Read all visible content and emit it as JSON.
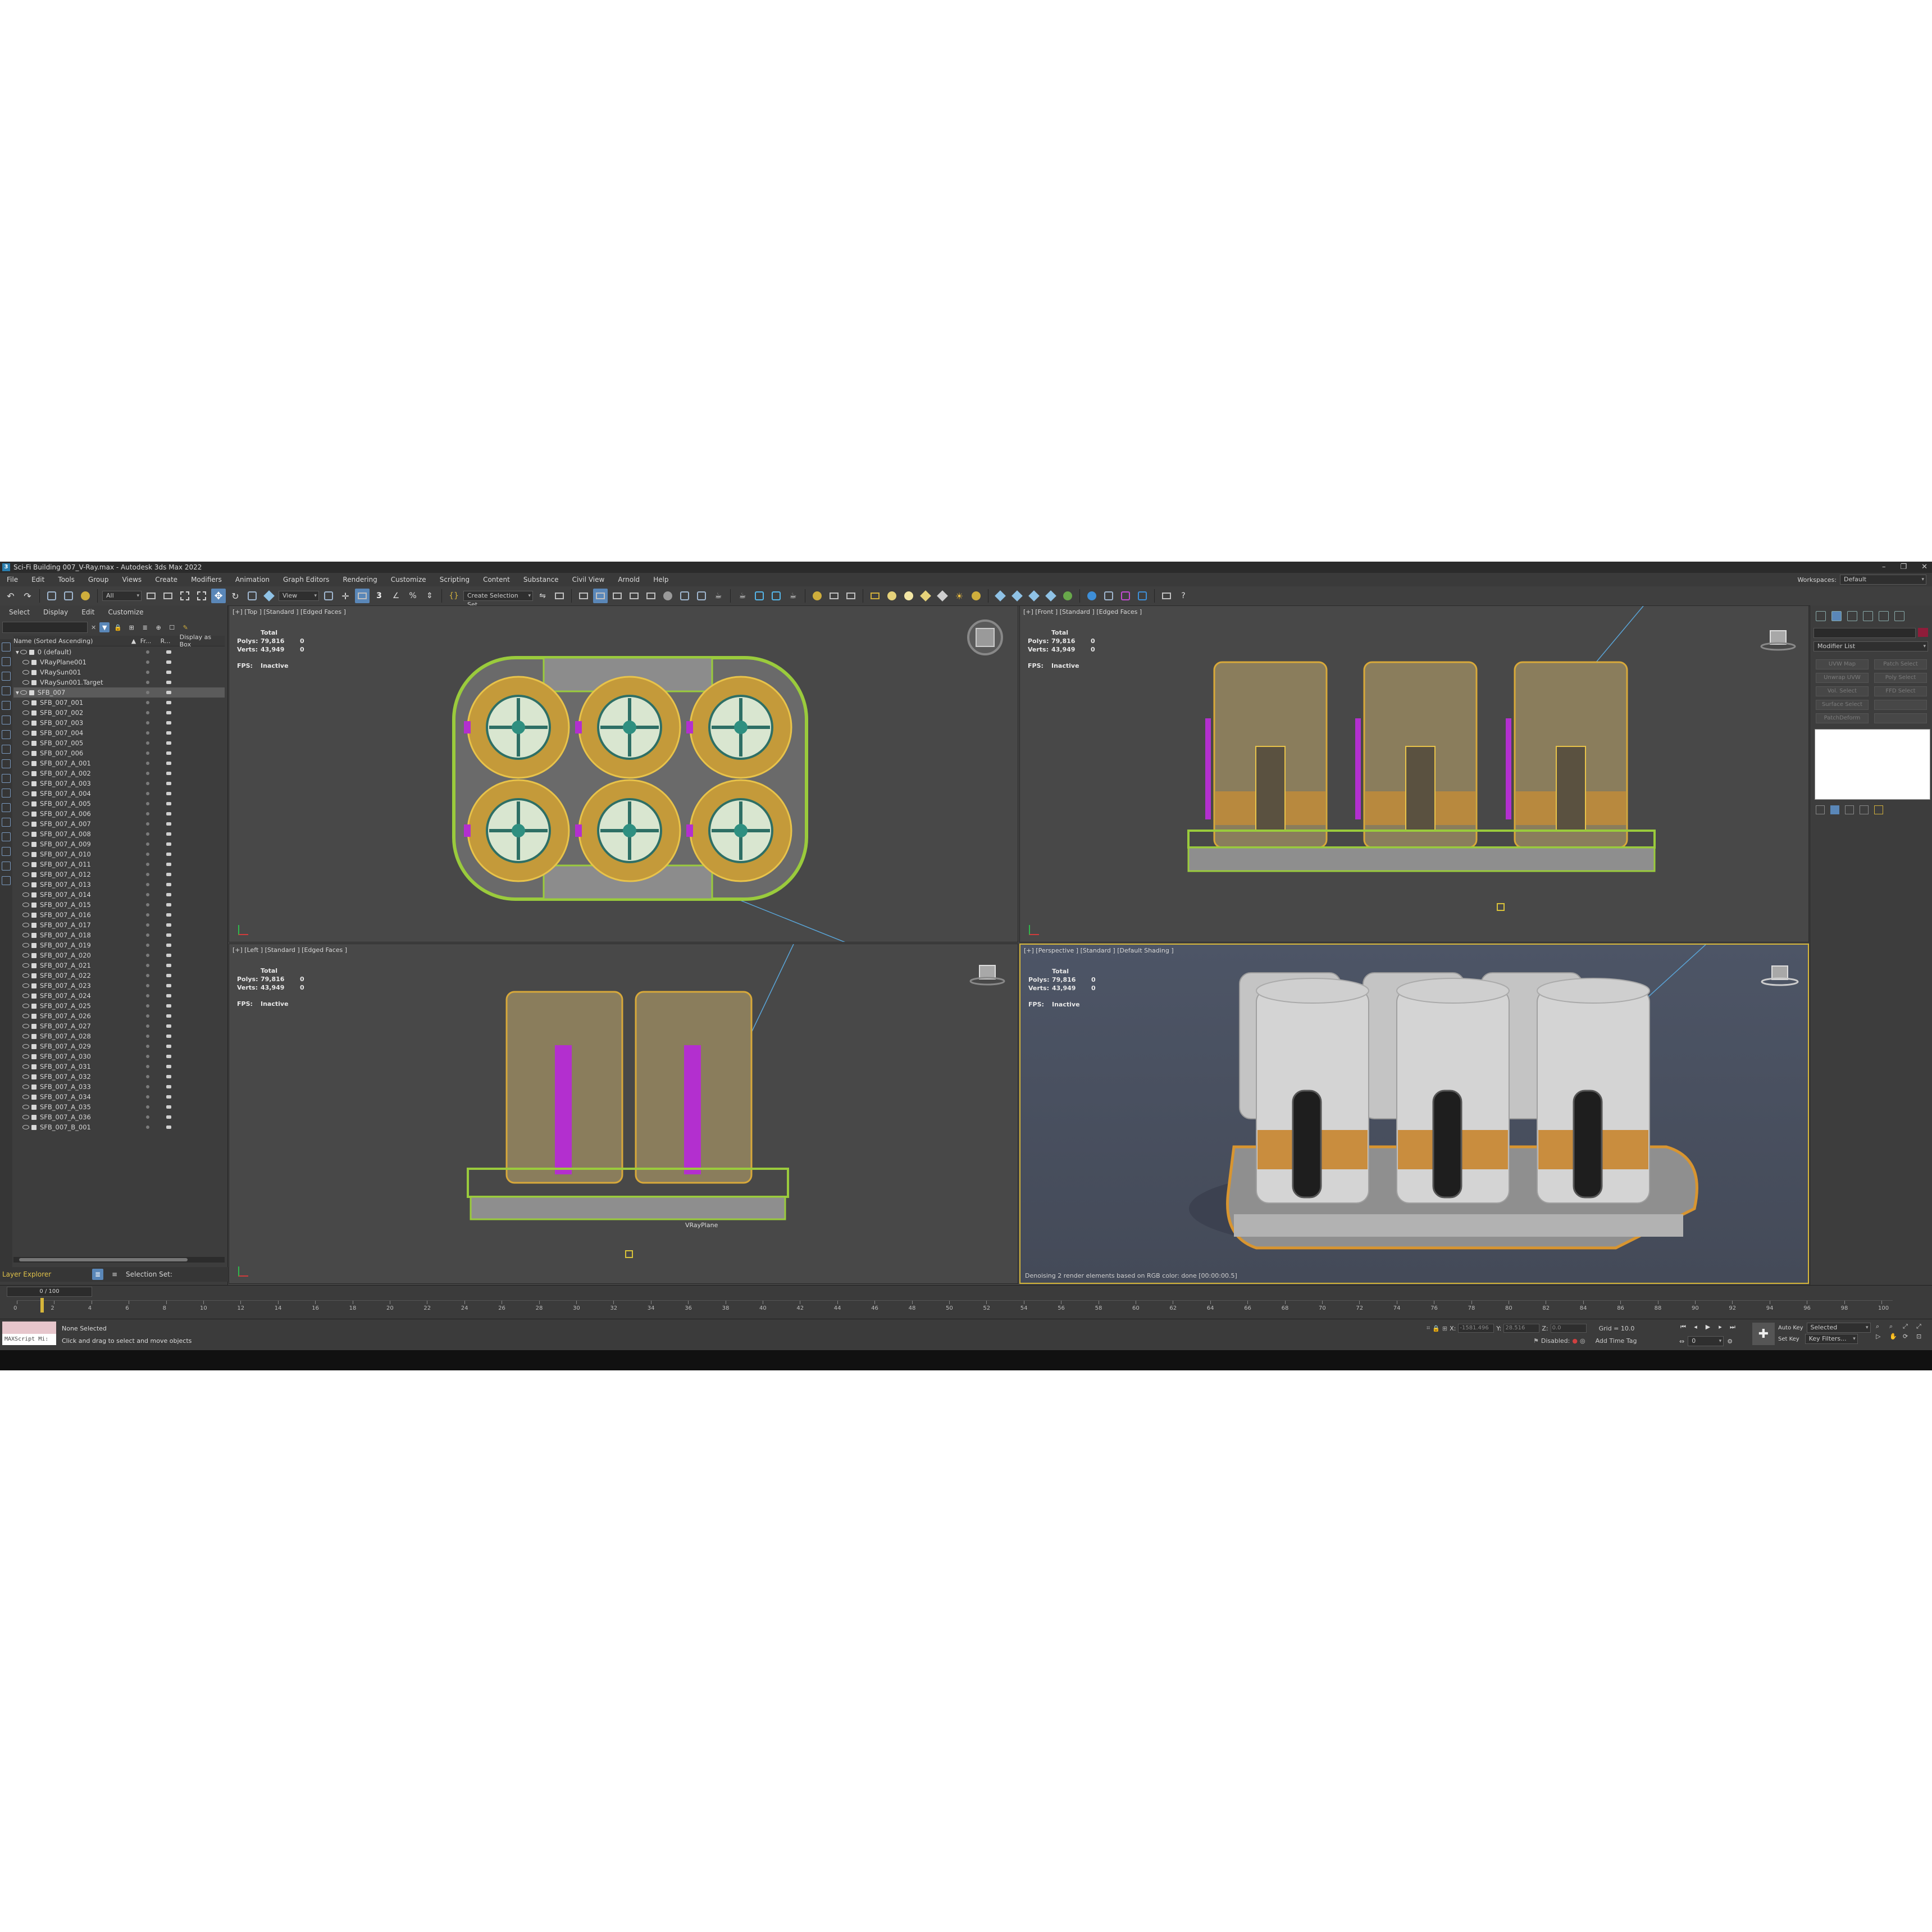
{
  "window": {
    "title": "Sci-Fi Building 007_V-Ray.max - Autodesk 3ds Max 2022",
    "minimize": "–",
    "restore": "❐",
    "close": "✕"
  },
  "menu": {
    "items": [
      "File",
      "Edit",
      "Tools",
      "Group",
      "Views",
      "Create",
      "Modifiers",
      "Animation",
      "Graph Editors",
      "Rendering",
      "Customize",
      "Scripting",
      "Content",
      "Substance",
      "Civil View",
      "Arnold",
      "Help"
    ],
    "workspaces_label": "Workspaces:",
    "workspaces_value": "Default"
  },
  "toolbar": {
    "filter_value": "All",
    "view_value": "View",
    "selection_set_placeholder": "Create Selection Set"
  },
  "explorer": {
    "tabs": [
      "Select",
      "Display",
      "Edit",
      "Customize"
    ],
    "col_name": "Name (Sorted Ascending)",
    "col_sort": "▲",
    "col_fr": "Fr...",
    "col_r": "R...",
    "col_box": "Display as Box",
    "search_clear": "✕",
    "layer_label": "Layer Explorer",
    "selection_set_label": "Selection Set:",
    "rows": [
      {
        "label": "0 (default)",
        "indent": 0,
        "sel": false
      },
      {
        "label": "VRayPlane001",
        "indent": 1,
        "sel": false
      },
      {
        "label": "VRaySun001",
        "indent": 1,
        "sel": false
      },
      {
        "label": "VRaySun001.Target",
        "indent": 1,
        "sel": false
      },
      {
        "label": "SFB_007",
        "indent": 0,
        "sel": true
      },
      {
        "label": "SFB_007_001",
        "indent": 1,
        "sel": false
      },
      {
        "label": "SFB_007_002",
        "indent": 1,
        "sel": false
      },
      {
        "label": "SFB_007_003",
        "indent": 1,
        "sel": false
      },
      {
        "label": "SFB_007_004",
        "indent": 1,
        "sel": false
      },
      {
        "label": "SFB_007_005",
        "indent": 1,
        "sel": false
      },
      {
        "label": "SFB_007_006",
        "indent": 1,
        "sel": false
      },
      {
        "label": "SFB_007_A_001",
        "indent": 1,
        "sel": false
      },
      {
        "label": "SFB_007_A_002",
        "indent": 1,
        "sel": false
      },
      {
        "label": "SFB_007_A_003",
        "indent": 1,
        "sel": false
      },
      {
        "label": "SFB_007_A_004",
        "indent": 1,
        "sel": false
      },
      {
        "label": "SFB_007_A_005",
        "indent": 1,
        "sel": false
      },
      {
        "label": "SFB_007_A_006",
        "indent": 1,
        "sel": false
      },
      {
        "label": "SFB_007_A_007",
        "indent": 1,
        "sel": false
      },
      {
        "label": "SFB_007_A_008",
        "indent": 1,
        "sel": false
      },
      {
        "label": "SFB_007_A_009",
        "indent": 1,
        "sel": false
      },
      {
        "label": "SFB_007_A_010",
        "indent": 1,
        "sel": false
      },
      {
        "label": "SFB_007_A_011",
        "indent": 1,
        "sel": false
      },
      {
        "label": "SFB_007_A_012",
        "indent": 1,
        "sel": false
      },
      {
        "label": "SFB_007_A_013",
        "indent": 1,
        "sel": false
      },
      {
        "label": "SFB_007_A_014",
        "indent": 1,
        "sel": false
      },
      {
        "label": "SFB_007_A_015",
        "indent": 1,
        "sel": false
      },
      {
        "label": "SFB_007_A_016",
        "indent": 1,
        "sel": false
      },
      {
        "label": "SFB_007_A_017",
        "indent": 1,
        "sel": false
      },
      {
        "label": "SFB_007_A_018",
        "indent": 1,
        "sel": false
      },
      {
        "label": "SFB_007_A_019",
        "indent": 1,
        "sel": false
      },
      {
        "label": "SFB_007_A_020",
        "indent": 1,
        "sel": false
      },
      {
        "label": "SFB_007_A_021",
        "indent": 1,
        "sel": false
      },
      {
        "label": "SFB_007_A_022",
        "indent": 1,
        "sel": false
      },
      {
        "label": "SFB_007_A_023",
        "indent": 1,
        "sel": false
      },
      {
        "label": "SFB_007_A_024",
        "indent": 1,
        "sel": false
      },
      {
        "label": "SFB_007_A_025",
        "indent": 1,
        "sel": false
      },
      {
        "label": "SFB_007_A_026",
        "indent": 1,
        "sel": false
      },
      {
        "label": "SFB_007_A_027",
        "indent": 1,
        "sel": false
      },
      {
        "label": "SFB_007_A_028",
        "indent": 1,
        "sel": false
      },
      {
        "label": "SFB_007_A_029",
        "indent": 1,
        "sel": false
      },
      {
        "label": "SFB_007_A_030",
        "indent": 1,
        "sel": false
      },
      {
        "label": "SFB_007_A_031",
        "indent": 1,
        "sel": false
      },
      {
        "label": "SFB_007_A_032",
        "indent": 1,
        "sel": false
      },
      {
        "label": "SFB_007_A_033",
        "indent": 1,
        "sel": false
      },
      {
        "label": "SFB_007_A_034",
        "indent": 1,
        "sel": false
      },
      {
        "label": "SFB_007_A_035",
        "indent": 1,
        "sel": false
      },
      {
        "label": "SFB_007_A_036",
        "indent": 1,
        "sel": false
      },
      {
        "label": "SFB_007_B_001",
        "indent": 1,
        "sel": false
      }
    ]
  },
  "viewports": {
    "stats": {
      "total": "Total",
      "polys_label": "Polys:",
      "polys": "79,816",
      "polys_sel": "0",
      "verts_label": "Verts:",
      "verts": "43,949",
      "verts_sel": "0",
      "fps_label": "FPS:",
      "fps": "Inactive"
    },
    "top": {
      "label": "[+] [Top ] [Standard ] [Edged Faces ]"
    },
    "front": {
      "label": "[+] [Front ] [Standard ] [Edged Faces ]"
    },
    "left": {
      "label": "[+] [Left ] [Standard ] [Edged Faces ]",
      "caption": "VRayPlane"
    },
    "persp": {
      "label": "[+] [Perspective ] [Standard ] [Default Shading ]",
      "message": "Denoising 2 render elements based on RGB color: done [00:00:00.5]"
    }
  },
  "command_panel": {
    "modifier_list": "Modifier List",
    "buttons": [
      "UVW Map",
      "Patch Select",
      "Unwrap UVW",
      "Poly Select",
      "Vol. Select",
      "FFD Select",
      "Surface Select",
      "",
      "PatchDeform",
      ""
    ]
  },
  "timeline": {
    "slider": "0 / 100",
    "ticks": [
      "0",
      "2",
      "4",
      "6",
      "8",
      "10",
      "12",
      "14",
      "16",
      "18",
      "20",
      "22",
      "24",
      "26",
      "28",
      "30",
      "32",
      "34",
      "36",
      "38",
      "40",
      "42",
      "44",
      "46",
      "48",
      "50",
      "52",
      "54",
      "56",
      "58",
      "60",
      "62",
      "64",
      "66",
      "68",
      "70",
      "72",
      "74",
      "76",
      "78",
      "80",
      "82",
      "84",
      "86",
      "88",
      "90",
      "92",
      "94",
      "96",
      "98",
      "100"
    ]
  },
  "status": {
    "maxscript": "MAXScript Mi:",
    "none_selected": "None Selected",
    "prompt": "Click and drag to select and move objects",
    "x_label": "X:",
    "x_value": "-1581.496",
    "y_label": "Y:",
    "y_value": "28.516",
    "z_label": "Z:",
    "z_value": "0.0",
    "grid": "Grid = 10.0",
    "disabled_label": "Disabled:",
    "add_time_tag": "Add Time Tag",
    "auto_key": "Auto Key",
    "selected": "Selected",
    "set_key": "Set Key",
    "key_filters": "Key Filters...",
    "frame_value": "0"
  }
}
